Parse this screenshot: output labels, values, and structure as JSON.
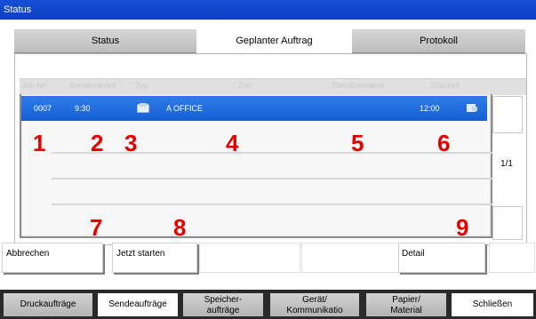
{
  "window": {
    "title": "Status"
  },
  "tabs": [
    {
      "label": "Status",
      "active": false
    },
    {
      "label": "Geplanter Auftrag",
      "active": true
    },
    {
      "label": "Protokoll",
      "active": false
    }
  ],
  "columns": [
    "Job-Nr.",
    "Annahmezeit",
    "Typ",
    "Ziel",
    "Benutzername",
    "Startzeit"
  ],
  "rows": [
    {
      "job": "0007",
      "time": "9:30",
      "type_icon": "send-job-icon",
      "dest": "A OFFICE",
      "user": "",
      "start": "12:00",
      "status_icon": "job-status-icon"
    }
  ],
  "callouts": [
    "1",
    "2",
    "3",
    "4",
    "5",
    "6",
    "7",
    "8",
    "9"
  ],
  "pager": {
    "text": "1/1"
  },
  "buttons": {
    "cancel": "Abbrechen",
    "start_now": "Jetzt starten",
    "detail": "Detail"
  },
  "bottom_tabs": [
    {
      "label": "Druckaufträge"
    },
    {
      "label": "Sendeaufträge",
      "active": true
    },
    {
      "line1": "Speicher-",
      "line2": "aufträge"
    },
    {
      "line1": "Gerät/",
      "line2": "Kommunikatio"
    },
    {
      "line1": "Papier/",
      "line2": "Material"
    },
    {
      "label": "Schließen"
    }
  ],
  "colors": {
    "title_bar": "#0b3fbd",
    "selection": "#1a66dc",
    "callout": "#e50000"
  }
}
